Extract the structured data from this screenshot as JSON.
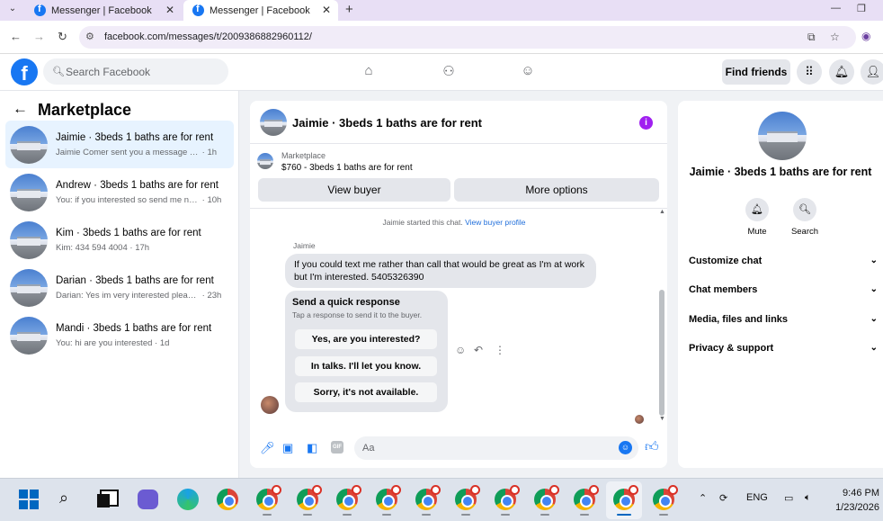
{
  "browser": {
    "tabs": [
      {
        "title": "Messenger | Facebook",
        "active": false
      },
      {
        "title": "Messenger | Facebook",
        "active": true
      }
    ],
    "new_tab_symbol": "+",
    "url": "facebook.com/messages/t/2009386882960112/",
    "icons": [
      "tab-search-icon",
      "back-icon",
      "forward-icon",
      "reload-icon",
      "site-info-icon",
      "install-app-icon",
      "bookmark-star-icon",
      "profile-icon"
    ]
  },
  "fb_topbar": {
    "logo_letter": "f",
    "search_placeholder": "Search Facebook",
    "nav_icons": [
      "home-icon",
      "friends-icon",
      "groups-icon"
    ],
    "find_friends_label": "Find friends",
    "right_icons": [
      "menu-grid-icon",
      "notifications-icon",
      "account-icon"
    ]
  },
  "left_panel": {
    "title": "Marketplace",
    "conversations": [
      {
        "title": "Jaimie · 3beds 1 baths are for rent",
        "snippet": "Jaimie Comer sent you a message ab...",
        "time": "· 1h",
        "active": true
      },
      {
        "title": "Andrew · 3beds 1 baths are for rent",
        "snippet": "You: if you interested so send me nu...",
        "time": "· 10h",
        "active": false
      },
      {
        "title": "Kim · 3beds 1 baths are for rent",
        "snippet": "Kim: 434 594 4004",
        "time": "· 17h",
        "active": false
      },
      {
        "title": "Darian · 3beds 1 baths are for rent",
        "snippet": "Darian: Yes im very interested please...",
        "time": "· 23h",
        "active": false
      },
      {
        "title": "Mandi · 3beds 1 baths are for rent",
        "snippet": "You: hi are you interested",
        "time": "· 1d",
        "active": false
      }
    ]
  },
  "chat": {
    "header_title": "Jaimie · 3beds 1 baths are for rent",
    "info_symbol": "i",
    "listing_label": "Marketplace",
    "listing_price_title": "$760 - 3beds 1 baths are for rent",
    "view_buyer_label": "View buyer",
    "more_options_label": "More options",
    "system_message": "Jaimie started this chat.",
    "system_link": "View buyer profile",
    "sender_name": "Jaimie",
    "message_text": "If you could text me rather than call that would be great as I'm at work but I'm interested. 5405326390",
    "quick_response": {
      "title": "Send a quick response",
      "subtitle": "Tap a response to send it to the buyer.",
      "options": [
        "Yes, are you interested?",
        "In talks. I'll let you know.",
        "Sorry, it's not available."
      ]
    },
    "composer_placeholder": "Aa",
    "composer_icons": [
      "microphone-icon",
      "photo-icon",
      "sticker-icon",
      "gif-icon"
    ],
    "gif_label": "GIF"
  },
  "right_panel": {
    "title": "Jaimie · 3beds 1 baths are for rent",
    "actions": [
      {
        "label": "Mute",
        "icon": "bell-icon"
      },
      {
        "label": "Search",
        "icon": "search-icon"
      }
    ],
    "sections": [
      "Customize chat",
      "Chat members",
      "Media, files and links",
      "Privacy & support"
    ]
  },
  "taskbar": {
    "language": "ENG",
    "time": "9:46 PM",
    "date": "1/23/2026"
  },
  "colors": {
    "fb_blue": "#1877f2",
    "active_conv_bg": "#e7f3ff",
    "info_purple": "#a020f0",
    "tab_strip": "#e8dff5"
  }
}
